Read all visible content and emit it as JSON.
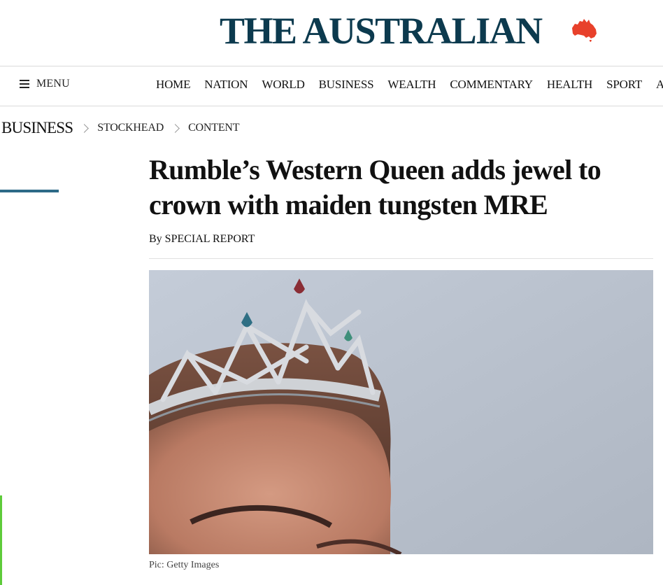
{
  "masthead": {
    "logo_text": "THE AUSTRALIAN",
    "logo_color": "#0c3a4e",
    "logo_icon": "australia-map-icon",
    "logo_icon_color": "#e8412b"
  },
  "nav": {
    "menu_label": "MENU",
    "menu_icon": "hamburger-icon",
    "items": [
      "HOME",
      "NATION",
      "WORLD",
      "BUSINESS",
      "WEALTH",
      "COMMENTARY",
      "HEALTH",
      "SPORT",
      "ARTS"
    ]
  },
  "breadcrumb": {
    "section": "BUSINESS",
    "items": [
      "STOCKHEAD",
      "CONTENT"
    ],
    "separator_icon": "chevron-right-icon"
  },
  "article": {
    "headline": "Rumble’s Western Queen adds jewel to crown with maiden tungsten MRE",
    "byline": "By SPECIAL REPORT",
    "image_caption": "Pic: Getty Images",
    "accent_color": "#2d6a87"
  }
}
